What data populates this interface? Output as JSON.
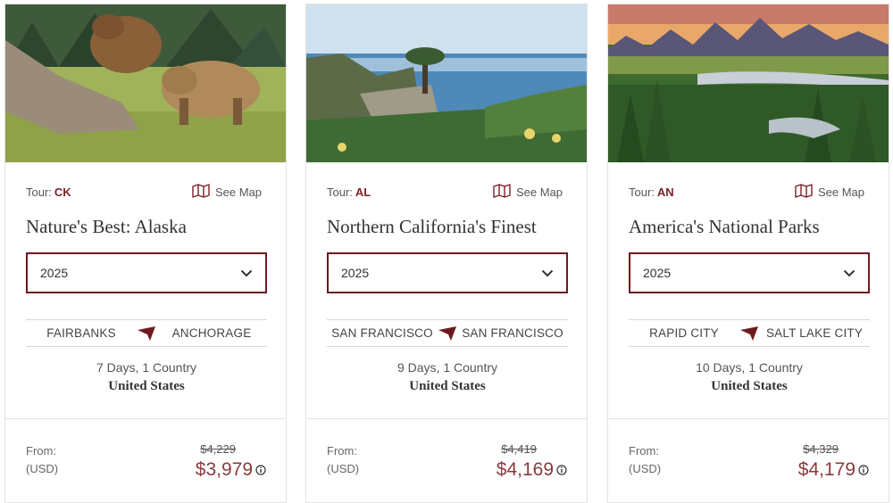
{
  "colors": {
    "accent": "#7a1f24",
    "price": "#8a3a3c",
    "border": "#6d1a1e"
  },
  "icons": {
    "map": "map-icon",
    "chevron": "chevron-down-icon",
    "plane": "plane-icon",
    "info": "info-icon"
  },
  "cards": [
    {
      "tour_label": "Tour:",
      "tour_code": "CK",
      "see_map": "See Map",
      "title": "Nature's Best: Alaska",
      "year": "2025",
      "route_from": "FAIRBANKS",
      "route_to": "ANCHORAGE",
      "duration": "7 Days, 1 Country",
      "country": "United States",
      "from_label": "From:",
      "currency": "(USD)",
      "original_price": "$4,229",
      "price": "$3,979"
    },
    {
      "tour_label": "Tour:",
      "tour_code": "AL",
      "see_map": "See Map",
      "title": "Northern California's Finest",
      "year": "2025",
      "route_from": "SAN FRANCISCO",
      "route_to": "SAN FRANCISCO",
      "duration": "9 Days, 1 Country",
      "country": "United States",
      "from_label": "From:",
      "currency": "(USD)",
      "original_price": "$4,419",
      "price": "$4,169"
    },
    {
      "tour_label": "Tour:",
      "tour_code": "AN",
      "see_map": "See Map",
      "title": "America's National Parks",
      "year": "2025",
      "route_from": "RAPID CITY",
      "route_to": "SALT LAKE CITY",
      "duration": "10 Days, 1 Country",
      "country": "United States",
      "from_label": "From:",
      "currency": "(USD)",
      "original_price": "$4,329",
      "price": "$4,179"
    }
  ]
}
